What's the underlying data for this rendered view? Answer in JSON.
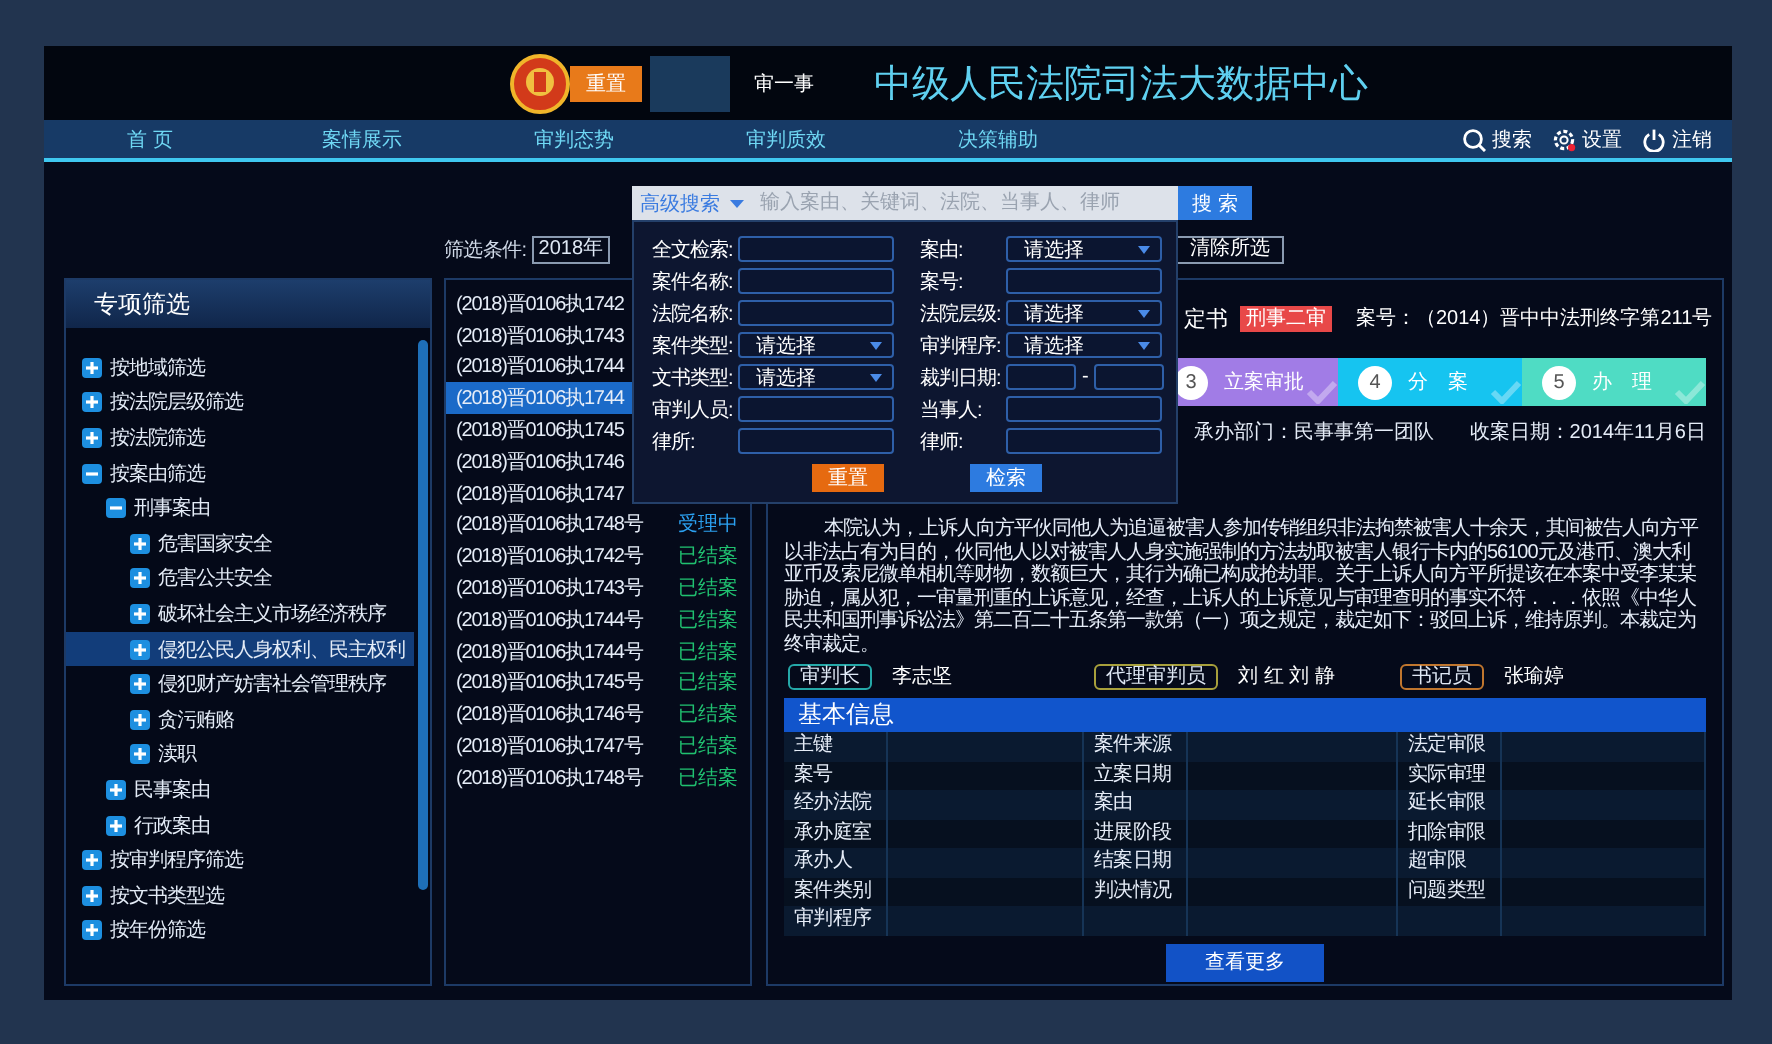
{
  "header": {
    "badge": "重置",
    "subtitle": "审一事",
    "title": "中级人民法院司法大数据中心"
  },
  "nav": {
    "items": [
      {
        "label": "首 页",
        "selected": false
      },
      {
        "label": "案情展示",
        "selected": false
      },
      {
        "label": "审判态势",
        "selected": false
      },
      {
        "label": "审判质效",
        "selected": false
      },
      {
        "label": "决策辅助",
        "selected": false
      }
    ],
    "actions": [
      {
        "kind": "search",
        "label": "搜索"
      },
      {
        "kind": "settings",
        "label": "设置"
      },
      {
        "kind": "logout",
        "label": "注销"
      }
    ]
  },
  "filter_bar": {
    "label": "筛选条件:",
    "chips": [
      "2018年"
    ],
    "clear_button": "清除所选"
  },
  "sidebar": {
    "title": "专项筛选",
    "items": [
      {
        "label": "按地域筛选",
        "expanded": false,
        "selected": false
      },
      {
        "label": "按法院层级筛选",
        "expanded": false,
        "selected": false
      },
      {
        "label": "按法院筛选",
        "expanded": false,
        "selected": false
      },
      {
        "label": "按案由筛选",
        "expanded": true,
        "selected": false,
        "children": [
          {
            "label": "刑事案由",
            "expanded": true,
            "selected": false,
            "children": [
              {
                "label": "危害国家安全",
                "expanded": false,
                "selected": false
              },
              {
                "label": "危害公共安全",
                "expanded": false,
                "selected": false
              },
              {
                "label": "破坏社会主义市场经济秩序",
                "expanded": false,
                "selected": false
              },
              {
                "label": "侵犯公民人身权利、民主权利",
                "expanded": false,
                "selected": true
              },
              {
                "label": "侵犯财产妨害社会管理秩序",
                "expanded": false,
                "selected": false
              },
              {
                "label": "贪污贿赂",
                "expanded": false,
                "selected": false
              },
              {
                "label": "渎职",
                "expanded": false,
                "selected": false
              }
            ]
          },
          {
            "label": "民事案由",
            "expanded": false,
            "selected": false
          },
          {
            "label": "行政案由",
            "expanded": false,
            "selected": false
          }
        ]
      },
      {
        "label": "按审判程序筛选",
        "expanded": false,
        "selected": false
      },
      {
        "label": "按文书类型选",
        "expanded": false,
        "selected": false
      },
      {
        "label": "按年份筛选",
        "expanded": false,
        "selected": false
      }
    ]
  },
  "cases": [
    {
      "number": "(2018)晋0106执1742",
      "selected": false
    },
    {
      "number": "(2018)晋0106执1743",
      "selected": false
    },
    {
      "number": "(2018)晋0106执1744",
      "selected": false
    },
    {
      "number": "(2018)晋0106执1744",
      "selected": true
    },
    {
      "number": "(2018)晋0106执1745",
      "selected": false
    },
    {
      "number": "(2018)晋0106执1746",
      "selected": false
    },
    {
      "number": "(2018)晋0106执1747",
      "selected": false
    },
    {
      "number": "(2018)晋0106执1748号",
      "status": "受理中",
      "color": "#2ba0f0",
      "selected": false
    },
    {
      "number": "(2018)晋0106执1742号",
      "status": "已结案",
      "color": "#20c070",
      "selected": false
    },
    {
      "number": "(2018)晋0106执1743号",
      "status": "已结案",
      "color": "#20c070",
      "selected": false
    },
    {
      "number": "(2018)晋0106执1744号",
      "status": "已结案",
      "color": "#20c070",
      "selected": false
    },
    {
      "number": "(2018)晋0106执1744号",
      "status": "已结案",
      "color": "#20c070",
      "selected": false
    },
    {
      "number": "(2018)晋0106执1745号",
      "status": "已结案",
      "color": "#20c070",
      "selected": false
    },
    {
      "number": "(2018)晋0106执1746号",
      "status": "已结案",
      "color": "#20c070",
      "selected": false
    },
    {
      "number": "(2018)晋0106执1747号",
      "status": "已结案",
      "color": "#20c070",
      "selected": false
    },
    {
      "number": "(2018)晋0106执1748号",
      "status": "已结案",
      "color": "#20c070",
      "selected": false
    }
  ],
  "document": {
    "title": "定书",
    "badge": "刑事二审",
    "case_no": "案号：（2014）晋中中法刑终字第211号",
    "steps": [
      {
        "num": "3",
        "label": "立案审批",
        "color": "#a17ce6"
      },
      {
        "num": "4",
        "label": "分　案",
        "color": "#16c4f0"
      },
      {
        "num": "5",
        "label": "办　理",
        "color": "#4fdcc4"
      }
    ],
    "department": "承办部门：民事事第一团队",
    "date": "收案日期：2014年11月6日",
    "body": "本院认为，上诉人向方平伙同他人为追逼被害人参加传销组织非法拘禁被害人十余天，其间被告人向方平以非法占有为目的，伙同他人以对被害人人身实施强制的方法劫取被害人银行卡内的56100元及港币、澳大利亚币及索尼微单相机等财物，数额巨大，其行为确已构成抢劫罪。关于上诉人向方平所提该在本案中受李某某胁迫，属从犯，一审量刑重的上诉意见，经查，上诉人的上诉意见与审理查明的事实不符．．．依照《中华人民共和国刑事诉讼法》第二百二十五条第一款第（一）项之规定，裁定如下：驳回上诉，维持原判。本裁定为终审裁定。",
    "judges": [
      {
        "role": "审判长",
        "names": "李志坚",
        "color": "#25a8a8"
      },
      {
        "role": "代理审判员",
        "names": "刘 红 刘 静",
        "color": "#a8a03c"
      },
      {
        "role": "书记员",
        "names": "张瑜婷",
        "color": "#c0762e"
      }
    ]
  },
  "basic_info": {
    "title": "基本信息",
    "rows": [
      [
        "主键",
        "案件来源",
        "法定审限"
      ],
      [
        "案号",
        "立案日期",
        "实际审理"
      ],
      [
        "经办法院",
        "案由",
        "延长审限"
      ],
      [
        "承办庭室",
        "进展阶段",
        "扣除审限"
      ],
      [
        "承办人",
        "结案日期",
        "超审限"
      ],
      [
        "案件类别",
        "判决情况",
        "问题类型"
      ],
      [
        "审判程序"
      ]
    ],
    "more_button": "查看更多"
  },
  "advanced_search": {
    "mode": "高级搜索",
    "placeholder": "输入案由、关键词、法院、当事人、律师",
    "search_button": "搜 索",
    "fields": [
      {
        "label": "全文检索:",
        "kind": "text"
      },
      {
        "label": "案由:",
        "kind": "select",
        "placeholder": "请选择"
      },
      {
        "label": "案件名称:",
        "kind": "text"
      },
      {
        "label": "案号:",
        "kind": "text"
      },
      {
        "label": "法院名称:",
        "kind": "text"
      },
      {
        "label": "法院层级:",
        "kind": "select",
        "placeholder": "请选择"
      },
      {
        "label": "案件类型:",
        "kind": "select",
        "placeholder": "请选择"
      },
      {
        "label": "审判程序:",
        "kind": "select",
        "placeholder": "请选择"
      },
      {
        "label": "文书类型:",
        "kind": "select",
        "placeholder": "请选择"
      },
      {
        "label": "裁判日期:",
        "kind": "date_range",
        "separator": "-"
      },
      {
        "label": "审判人员:",
        "kind": "text"
      },
      {
        "label": "当事人:",
        "kind": "text"
      },
      {
        "label": "律所:",
        "kind": "text"
      },
      {
        "label": "律师:",
        "kind": "text"
      }
    ],
    "reset_button": "重置",
    "submit_button": "检索"
  }
}
